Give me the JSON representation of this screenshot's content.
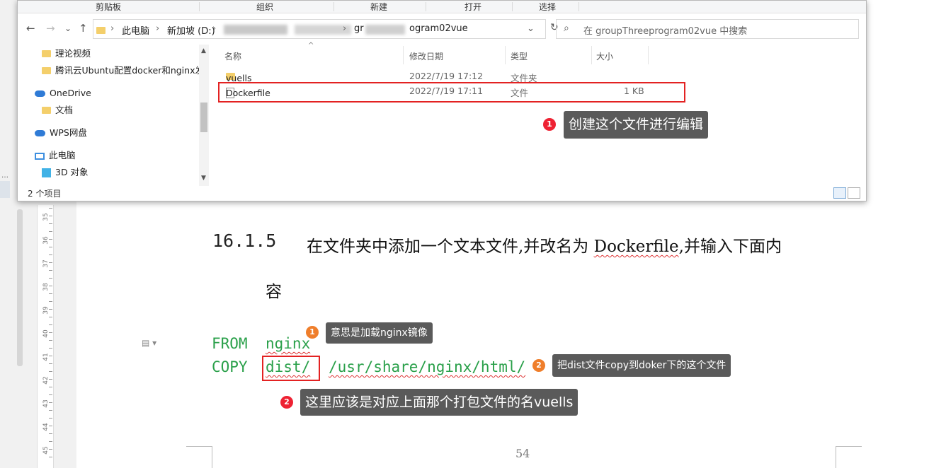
{
  "explorer": {
    "ribbon": [
      "剪贴板",
      "组织",
      "新建",
      "打开",
      "选择"
    ],
    "nav": {
      "back": "←",
      "forward": "→",
      "down": "⌄",
      "up": "↑"
    },
    "address": {
      "segments": [
        "此电脑",
        "新加坡 (D:)"
      ],
      "blurred_tail": "gr",
      "last_fragment": "ogram02vue"
    },
    "search_placeholder": "在 groupThreeprogram02vue 中搜索",
    "nav_pane": {
      "items": [
        {
          "label": "理论视频",
          "icon": "folder-icon"
        },
        {
          "label": "腾讯云Ubuntu配置docker和nginx发:",
          "icon": "folder-icon"
        },
        {
          "label": "OneDrive",
          "icon": "cloud-icon"
        },
        {
          "label": "文档",
          "icon": "folder-icon"
        },
        {
          "label": "WPS网盘",
          "icon": "cloud-icon"
        },
        {
          "label": "此电脑",
          "icon": "pc-icon"
        },
        {
          "label": "3D 对象",
          "icon": "cube-icon"
        }
      ]
    },
    "columns": {
      "name": "名称",
      "date": "修改日期",
      "type": "类型",
      "size": "大小"
    },
    "files": [
      {
        "name": "vuells",
        "date": "2022/7/19 17:12",
        "type": "文件夹",
        "size": ""
      },
      {
        "name": "Dockerfile",
        "date": "2022/7/19 17:11",
        "type": "文件",
        "size": "1 KB"
      }
    ],
    "status": "2 个项目"
  },
  "annotations": {
    "explorer_tip": {
      "badge": "1",
      "text": "创建这个文件进行编辑"
    },
    "tip_orange_1": {
      "badge": "1",
      "text": "意思是加载nginx镜像"
    },
    "tip_orange_2": {
      "badge": "2",
      "text": "把dist文件copy到doker下的这个文件"
    },
    "tip_red_2": {
      "badge": "2",
      "text": "这里应该是对应上面那个打包文件的名vuells"
    }
  },
  "document": {
    "heading_number": "16.1.5",
    "heading_text_part1": "在文件夹中添加一个文本文件,并改名为 ",
    "heading_text_dockerfile": "Dockerfile",
    "heading_text_part2": ",并输入下面内",
    "heading_text_line2": "容",
    "code": {
      "line1_kw": "FROM",
      "line1_arg": "nginx",
      "line2_kw": "COPY",
      "line2_src": "dist/",
      "line2_dst": "/usr/share/nginx/html/"
    },
    "page_number": "54",
    "ruler_numbers": [
      "35",
      "36",
      "37",
      "38",
      "39",
      "40",
      "41",
      "42",
      "43",
      "44",
      "45"
    ]
  },
  "colors": {
    "code_green": "#2aa04a",
    "annot_red": "#e32222",
    "badge_orange": "#ef7e2b",
    "tip_bg": "#5a5a5a"
  }
}
